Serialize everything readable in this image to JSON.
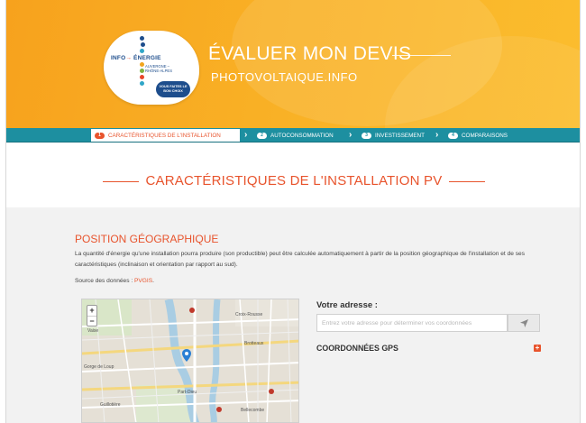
{
  "header": {
    "logo": {
      "brand_left": "INFO",
      "brand_right": "ÉNERGIE",
      "region": "AUVERGNE – RHÔNE-ALPES",
      "tagline": "VOUS FAITES LE BON CHOIX"
    },
    "title": "ÉVALUER MON DEVIS",
    "subtitle": "PHOTOVOLTAIQUE.INFO"
  },
  "steps": [
    {
      "number": "1",
      "label": "CARACTÉRISTIQUES DE L'INSTALLATION",
      "active": true
    },
    {
      "number": "2",
      "label": "AUTOCONSOMMATION",
      "active": false
    },
    {
      "number": "3",
      "label": "INVESTISSEMENT",
      "active": false
    },
    {
      "number": "4",
      "label": "COMPARAISONS",
      "active": false
    }
  ],
  "page_heading": "CARACTÉRISTIQUES DE L'INSTALLATION PV",
  "section": {
    "title": "POSITION GÉOGRAPHIQUE",
    "paragraph": "La quantité d'énergie qu'une installation pourra produire (son productible) peut être calculée automatiquement à partir de la position géographique de l'installation et de ses caractéristiques (inclinaison et orientation par rapport au sud).",
    "source_prefix": "Source des données : ",
    "source_link": "PVGIS",
    "source_suffix": "."
  },
  "map": {
    "zoom_in": "+",
    "zoom_out": "−",
    "labels": [
      "Vaise",
      "Gorge de Loup",
      "Croix-Rousse",
      "Brotteaux",
      "Part-Dieu",
      "Bellecombe",
      "Guillotière"
    ]
  },
  "address": {
    "label": "Votre adresse :",
    "value": "",
    "placeholder": "Entrez votre adresse pour déterminer vos coordonnées",
    "gps_label": "COORDONNÉES GPS",
    "gps_toggle": "+"
  },
  "colors": {
    "accent": "#e8542d",
    "header_orange": "#f9b025",
    "teal": "#1d8fa0",
    "brand_blue": "#1d4d8c"
  },
  "icons": {
    "locate": "location-arrow-icon",
    "pin": "map-pin-icon",
    "expand": "plus-icon"
  }
}
